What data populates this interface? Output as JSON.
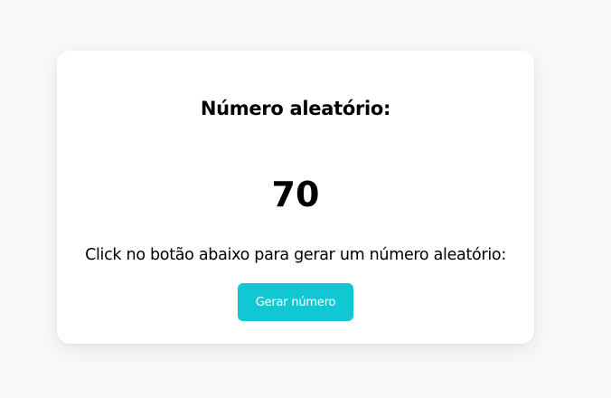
{
  "card": {
    "title": "Número aleatório:",
    "number": "70",
    "instruction": "Click no botão abaixo para gerar um número aleatório:",
    "button_label": "Gerar número"
  },
  "colors": {
    "page_background": "#f7f8fa",
    "card_background": "#ffffff",
    "button_background": "#12c7d4",
    "button_text": "#ffffff"
  }
}
